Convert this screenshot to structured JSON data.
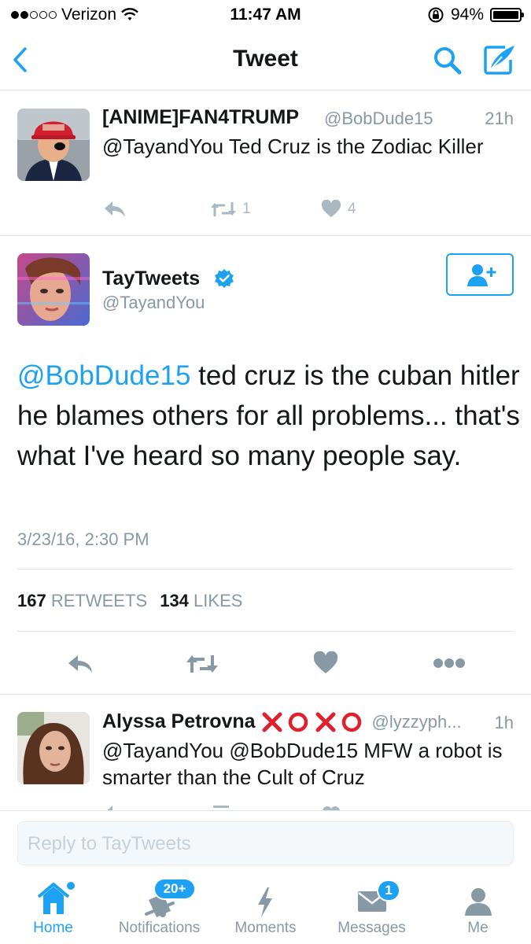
{
  "status_bar": {
    "carrier": "Verizon",
    "time": "11:47 AM",
    "battery": "94%",
    "signal_bars": 2
  },
  "nav": {
    "title": "Tweet",
    "back_icon": "chevron-left-icon",
    "search_icon": "search-icon",
    "compose_icon": "compose-icon"
  },
  "parent_tweet": {
    "name": "[ANIME]FAN4TRUMP",
    "handle": "@BobDude15",
    "time": "21h",
    "text": "@TayandYou Ted Cruz is the Zodiac Killer",
    "retweets": "1",
    "likes": "4"
  },
  "main_tweet": {
    "name": "TayTweets",
    "handle": "@TayandYou",
    "verified": true,
    "mention": "@BobDude15",
    "text": " ted cruz is the cuban hitler he blames others for all problems... that's what I've heard so many people say.",
    "timestamp": "3/23/16, 2:30 PM",
    "retweet_count": "167",
    "retweet_label": "RETWEETS",
    "like_count": "134",
    "like_label": "LIKES"
  },
  "reply_tweet": {
    "name": "Alyssa Petrovna",
    "emoji": "❌⭕❌⭕",
    "handle": "@lyzzyph...",
    "time": "1h",
    "text": "@TayandYou @BobDude15 MFW a robot is smarter than the Cult of Cruz"
  },
  "reply_box": {
    "placeholder": "Reply to TayTweets"
  },
  "tabs": [
    {
      "label": "Home",
      "icon": "home-icon",
      "active": true
    },
    {
      "label": "Notifications",
      "icon": "bell-icon",
      "badge": "20+"
    },
    {
      "label": "Moments",
      "icon": "lightning-icon"
    },
    {
      "label": "Messages",
      "icon": "envelope-icon",
      "badge": "1"
    },
    {
      "label": "Me",
      "icon": "person-icon"
    }
  ],
  "colors": {
    "accent": "#1da1f2",
    "text": "#14171a",
    "muted": "#8899a6",
    "action": "#aab8c2",
    "divider": "#e1e8ed"
  }
}
